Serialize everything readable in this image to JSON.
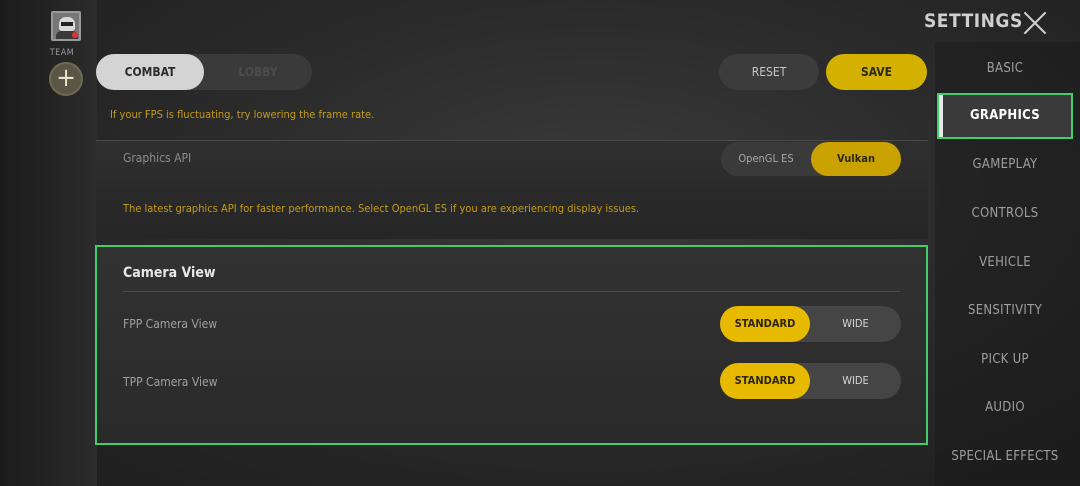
{
  "left_rail": {
    "team_label": "TEAM",
    "add_icon": "plus-icon"
  },
  "top_tabs": {
    "combat": "COMBAT",
    "lobby": "LOBBY"
  },
  "actions": {
    "reset": "RESET",
    "save": "SAVE"
  },
  "fps_hint": "If your FPS is fluctuating, try lowering the frame rate.",
  "graphics_api": {
    "label": "Graphics API",
    "options": [
      "OpenGL ES",
      "Vulkan"
    ],
    "selected": "Vulkan",
    "description": "The latest graphics API for faster performance. Select OpenGL ES if you are experiencing display issues."
  },
  "camera_view": {
    "title": "Camera View",
    "rows": [
      {
        "label": "FPP Camera View",
        "options": [
          "STANDARD",
          "WIDE"
        ],
        "selected": "STANDARD"
      },
      {
        "label": "TPP Camera View",
        "options": [
          "STANDARD",
          "WIDE"
        ],
        "selected": "STANDARD"
      }
    ]
  },
  "settings": {
    "title": "SETTINGS",
    "close_icon": "close-icon",
    "menu": [
      "BASIC",
      "GRAPHICS",
      "GAMEPLAY",
      "CONTROLS",
      "VEHICLE",
      "SENSITIVITY",
      "PICK UP",
      "AUDIO",
      "SPECIAL EFFECTS"
    ],
    "active": "GRAPHICS"
  },
  "colors": {
    "accent_yellow": "#e7ba00",
    "highlight_green": "#3fcf6a"
  }
}
